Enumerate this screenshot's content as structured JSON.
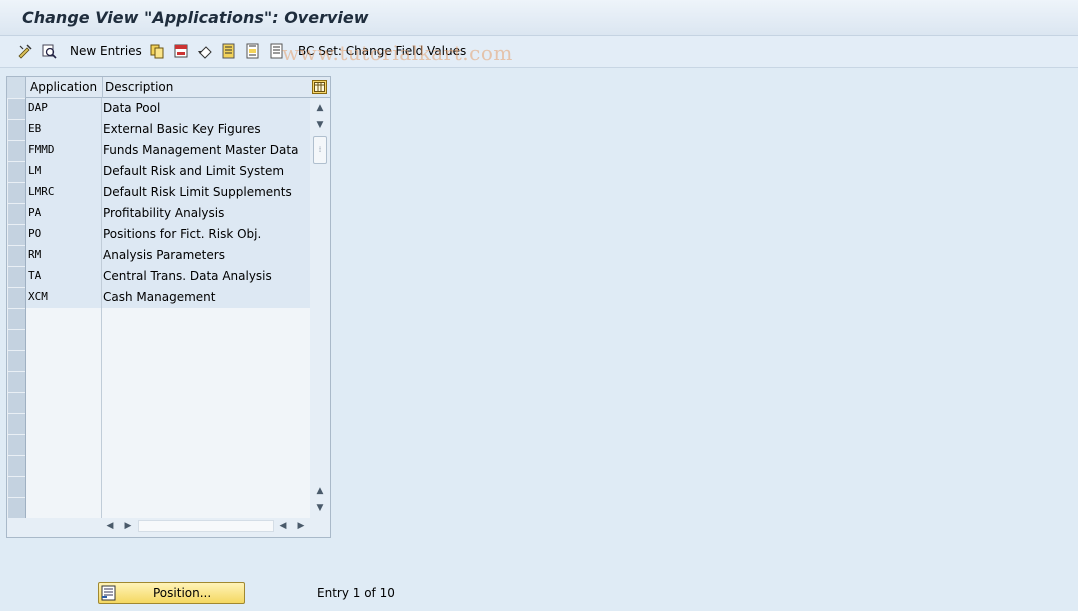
{
  "window": {
    "title": "Change View \"Applications\": Overview"
  },
  "toolbar": {
    "new_entries_label": "New Entries",
    "bc_set_label": "BC Set: Change Field Values",
    "icons": [
      "display-change-icon",
      "other-view-icon",
      "copy-icon",
      "delete-icon",
      "undo-icon",
      "select-all-icon",
      "select-block-icon",
      "deselect-all-icon"
    ]
  },
  "watermark": "www.tutorialkart.com",
  "table": {
    "columns": [
      "Application",
      "Description"
    ],
    "rows": [
      {
        "application": "DAP",
        "description": "Data Pool"
      },
      {
        "application": "EB",
        "description": "External Basic Key Figures"
      },
      {
        "application": "FMMD",
        "description": "Funds Management Master Data"
      },
      {
        "application": "LM",
        "description": "Default Risk and Limit System"
      },
      {
        "application": "LMRC",
        "description": "Default Risk Limit Supplements"
      },
      {
        "application": "PA",
        "description": "Profitability Analysis"
      },
      {
        "application": "PO",
        "description": "Positions for Fict. Risk Obj."
      },
      {
        "application": "RM",
        "description": "Analysis Parameters"
      },
      {
        "application": "TA",
        "description": "Central Trans. Data Analysis"
      },
      {
        "application": "XCM",
        "description": "Cash Management"
      }
    ],
    "empty_rows": 10
  },
  "footer": {
    "position_button_label": "Position...",
    "entry_status": "Entry 1 of 10"
  }
}
